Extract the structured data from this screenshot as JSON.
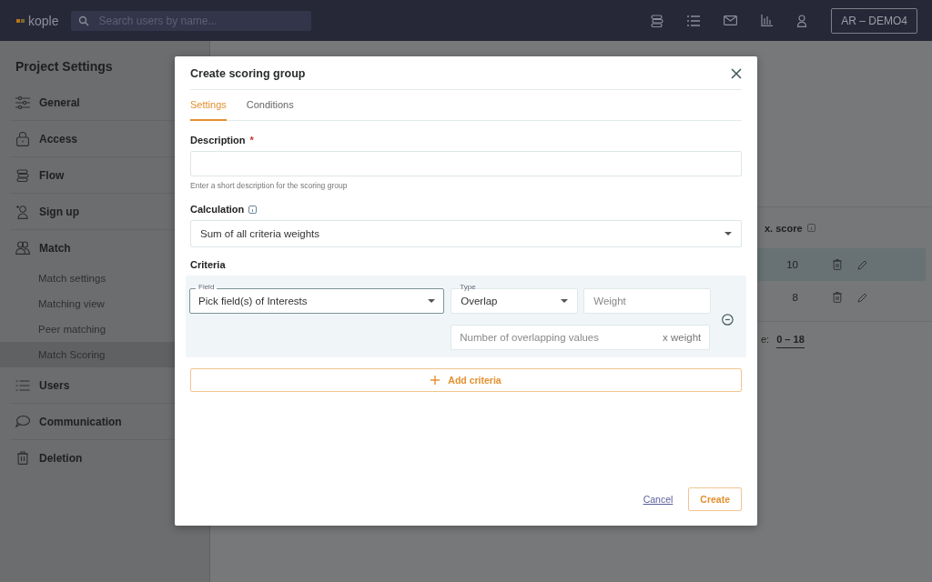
{
  "topbar": {
    "logo": "kople",
    "search": {
      "placeholder": "Search users by name..."
    },
    "account": "AR – DEMO4"
  },
  "sidebar": {
    "title": "Project Settings",
    "items": [
      {
        "label": "General"
      },
      {
        "label": "Access"
      },
      {
        "label": "Flow"
      },
      {
        "label": "Sign up"
      },
      {
        "label": "Match",
        "children": [
          {
            "label": "Match settings",
            "selected": false
          },
          {
            "label": "Matching view",
            "selected": false
          },
          {
            "label": "Peer matching",
            "selected": false
          },
          {
            "label": "Match Scoring",
            "selected": true
          }
        ]
      },
      {
        "label": "Users"
      },
      {
        "label": "Communication"
      },
      {
        "label": "Deletion"
      }
    ]
  },
  "background_table": {
    "column_heading": "x. score",
    "rows": [
      {
        "value": "10",
        "highlighted": true
      },
      {
        "value": "8",
        "highlighted": false
      }
    ],
    "range_label": "e:",
    "range": "0 – 18"
  },
  "dialog": {
    "title": "Create scoring group",
    "tabs": [
      {
        "label": "Settings",
        "selected": true
      },
      {
        "label": "Conditions",
        "selected": false
      }
    ],
    "description": {
      "label": "Description",
      "required_mark": "*",
      "helper": "Enter a short description for the scoring group"
    },
    "calculation": {
      "label": "Calculation",
      "value": "Sum of all criteria weights"
    },
    "criteria": {
      "label": "Criteria",
      "rows": [
        {
          "field_label": "Field",
          "field_value": "Pick field(s) of Interests",
          "type_label": "Type",
          "type_value": "Overlap",
          "weight_placeholder": "Weight",
          "formula_placeholder": "Number of overlapping values",
          "formula_suffix": "x weight"
        }
      ],
      "add_button": "Add criteria"
    },
    "buttons": {
      "cancel": "Cancel",
      "create": "Create"
    }
  }
}
